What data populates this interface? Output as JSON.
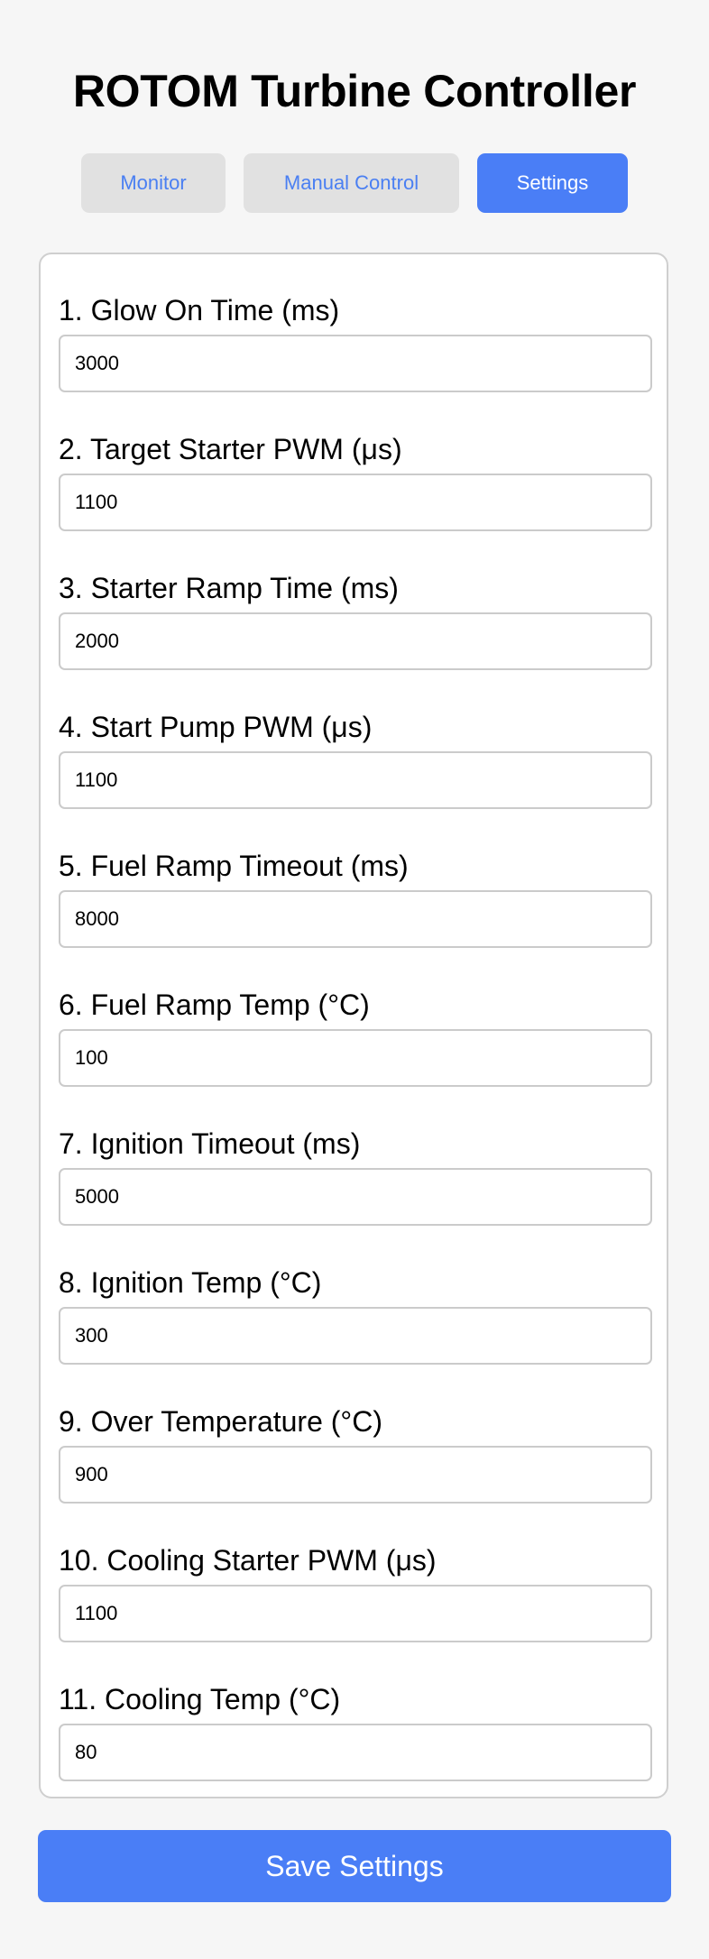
{
  "header": {
    "title": "ROTOM Turbine Controller"
  },
  "tabs": [
    {
      "label": "Monitor",
      "active": false
    },
    {
      "label": "Manual Control",
      "active": false
    },
    {
      "label": "Settings",
      "active": true
    }
  ],
  "settings": {
    "fields": [
      {
        "label": "1. Glow On Time (ms)",
        "value": "3000"
      },
      {
        "label": "2. Target Starter PWM (μs)",
        "value": "1100"
      },
      {
        "label": "3. Starter Ramp Time (ms)",
        "value": "2000"
      },
      {
        "label": "4. Start Pump PWM (μs)",
        "value": "1100"
      },
      {
        "label": "5. Fuel Ramp Timeout (ms)",
        "value": "8000"
      },
      {
        "label": "6. Fuel Ramp Temp (°C)",
        "value": "100"
      },
      {
        "label": "7. Ignition Timeout (ms)",
        "value": "5000"
      },
      {
        "label": "8. Ignition Temp (°C)",
        "value": "300"
      },
      {
        "label": "9. Over Temperature (°C)",
        "value": "900"
      },
      {
        "label": "10. Cooling Starter PWM (μs)",
        "value": "1100"
      },
      {
        "label": "11. Cooling Temp (°C)",
        "value": "80"
      }
    ],
    "save_label": "Save Settings"
  },
  "colors": {
    "accent": "#4a7ef6",
    "inactive_tab_bg": "#e1e1e1",
    "inactive_tab_text": "#4a7ff2",
    "page_bg": "#f6f6f6"
  }
}
